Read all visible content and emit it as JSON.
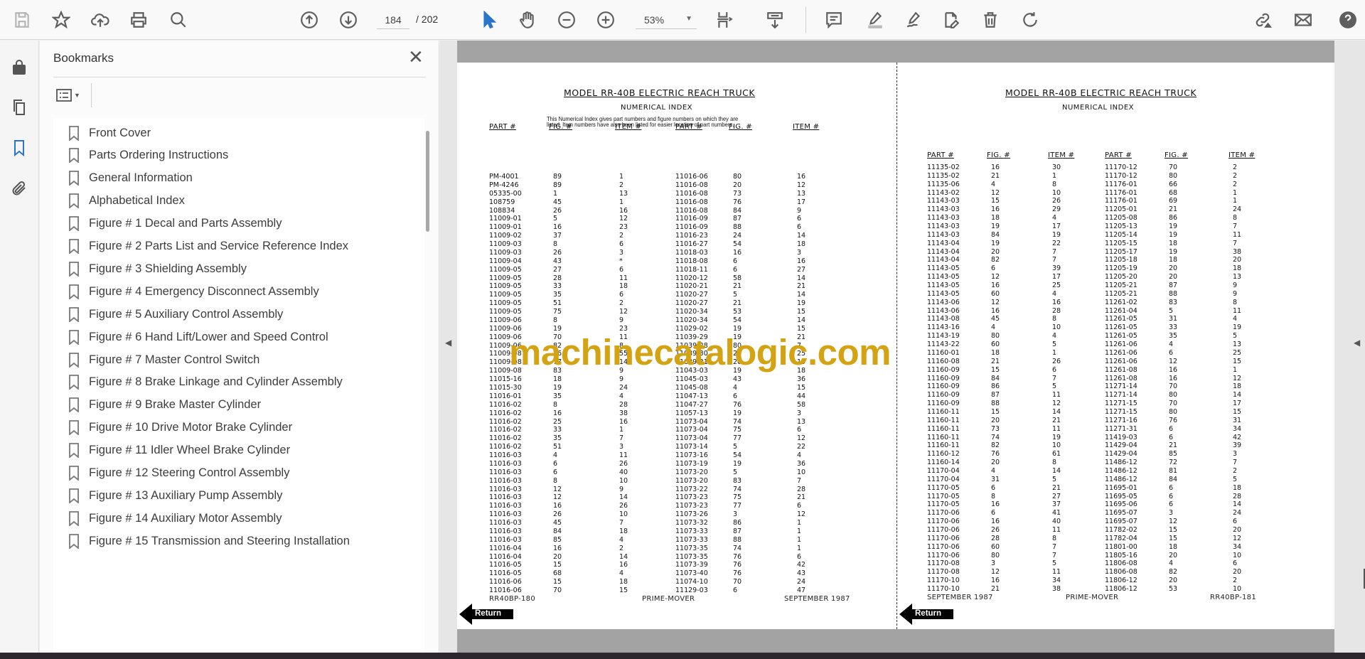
{
  "toolbar": {
    "icons": [
      "save-icon",
      "bookmark-star-icon",
      "upload-cloud-icon",
      "print-icon",
      "find-text-icon",
      "page-up-icon",
      "page-down-icon",
      "select-cursor-icon",
      "hand-pan-icon",
      "zoom-out-icon",
      "zoom-in-icon",
      "fit-page-icon",
      "scroll-mode-icon",
      "comment-icon",
      "highlight-icon",
      "sign-icon",
      "edit-pdf-icon",
      "delete-icon",
      "rotate-icon",
      "share-link-icon",
      "email-icon",
      "help-icon"
    ],
    "page_current": "184",
    "page_total": "/ 202",
    "zoom": "53%"
  },
  "rail": {
    "icons": [
      "lock-icon",
      "pages-icon",
      "bookmarks-icon",
      "attachments-icon"
    ],
    "active": "bookmarks-icon",
    "active_color": "#2b74c9"
  },
  "bookmarks": {
    "title": "Bookmarks",
    "close": "✕",
    "items": [
      "Front Cover",
      "Parts Ordering Instructions",
      "General Information",
      "Alphabetical Index",
      "Figure # 1 Decal and Parts Assembly",
      "Figure # 2 Parts List and Service Reference Index",
      "Figure # 3 Shielding Assembly",
      "Figure # 4 Emergency Disconnect Assembly",
      "Figure # 5 Auxiliary Control Assembly",
      "Figure # 6 Hand Lift/Lower and Speed Control",
      "Figure # 7 Master Control Switch",
      "Figure # 8 Brake Linkage and Cylinder Assembly",
      "Figure # 9 Brake Master Cylinder",
      "Figure # 10 Drive Motor Brake Cylinder",
      "Figure # 11 Idler Wheel Brake Cylinder",
      "Figure # 12 Steering Control Assembly",
      "Figure # 13 Auxiliary Pump Assembly",
      "Figure # 14 Auxiliary Motor Assembly",
      "Figure # 15 Transmission and Steering Installation"
    ]
  },
  "watermark": "machinecatalogic.com",
  "pages": {
    "left": {
      "title": "MODEL RR-40B ELECTRIC REACH TRUCK",
      "subtitle": "NUMERICAL INDEX",
      "note_line1": "This Numerical Index gives part numbers and figure numbers on which they are",
      "note_line2": "listed.  Item numbers have also been listed for easier location of part numbers.",
      "headers": [
        "PART #",
        "FIG. #",
        "ITEM #",
        "PART #",
        "FIG. #",
        "ITEM #"
      ],
      "col1": [
        [
          "PM-4001",
          "89",
          "1"
        ],
        [
          "PM-4246",
          "89",
          "2"
        ],
        [
          "05335-00",
          "1",
          "13"
        ],
        [
          "108759",
          "45",
          "1"
        ],
        [
          "108834",
          "26",
          "16"
        ],
        [
          "11009-01",
          "5",
          "12"
        ],
        [
          "11009-01",
          "16",
          "23"
        ],
        [
          "11009-02",
          "37",
          "2"
        ],
        [
          "11009-03",
          "8",
          "6"
        ],
        [
          "11009-03",
          "26",
          "3"
        ],
        [
          "11009-04",
          "43",
          "*"
        ],
        [
          "11009-05",
          "27",
          "6"
        ],
        [
          "11009-05",
          "28",
          "11"
        ],
        [
          "11009-05",
          "33",
          "18"
        ],
        [
          "11009-05",
          "35",
          "6"
        ],
        [
          "11009-05",
          "51",
          "2"
        ],
        [
          "11009-05",
          "75",
          "12"
        ],
        [
          "11009-06",
          "8",
          "9"
        ],
        [
          "11009-06",
          "19",
          "23"
        ],
        [
          "11009-06",
          "70",
          "11"
        ],
        [
          "11009-06",
          "82",
          "8"
        ],
        [
          "11009-08",
          "76",
          "55"
        ],
        [
          "11009-08",
          "77",
          "14"
        ],
        [
          "11009-08",
          "83",
          "9"
        ],
        [
          "11015-16",
          "18",
          "9"
        ],
        [
          "11015-30",
          "19",
          "24"
        ],
        [
          "11016-01",
          "35",
          "4"
        ],
        [
          "11016-02",
          "8",
          "28"
        ],
        [
          "11016-02",
          "16",
          "38"
        ],
        [
          "11016-02",
          "25",
          "16"
        ],
        [
          "11016-02",
          "33",
          "1"
        ],
        [
          "11016-02",
          "35",
          "7"
        ],
        [
          "11016-02",
          "51",
          "3"
        ],
        [
          "11016-03",
          "4",
          "11"
        ],
        [
          "11016-03",
          "6",
          "26"
        ],
        [
          "11016-03",
          "6",
          "40"
        ],
        [
          "11016-03",
          "8",
          "10"
        ],
        [
          "11016-03",
          "12",
          "9"
        ],
        [
          "11016-03",
          "12",
          "14"
        ],
        [
          "11016-03",
          "16",
          "26"
        ],
        [
          "11016-03",
          "26",
          "10"
        ],
        [
          "11016-03",
          "45",
          "7"
        ],
        [
          "11016-03",
          "84",
          "18"
        ],
        [
          "11016-03",
          "85",
          "4"
        ],
        [
          "11016-04",
          "16",
          "2"
        ],
        [
          "11016-04",
          "20",
          "14"
        ],
        [
          "11016-05",
          "15",
          "16"
        ],
        [
          "11016-05",
          "68",
          "4"
        ],
        [
          "11016-06",
          "15",
          "18"
        ],
        [
          "11016-06",
          "70",
          "15"
        ]
      ],
      "col2": [
        [
          "11016-06",
          "80",
          "16"
        ],
        [
          "11016-08",
          "20",
          "12"
        ],
        [
          "11016-08",
          "73",
          "13"
        ],
        [
          "11016-08",
          "76",
          "17"
        ],
        [
          "11016-08",
          "84",
          "9"
        ],
        [
          "11016-09",
          "87",
          "6"
        ],
        [
          "11016-09",
          "88",
          "6"
        ],
        [
          "11016-23",
          "24",
          "14"
        ],
        [
          "11016-27",
          "54",
          "18"
        ],
        [
          "11018-03",
          "16",
          "3"
        ],
        [
          "11018-08",
          "6",
          "16"
        ],
        [
          "11018-11",
          "6",
          "27"
        ],
        [
          "11020-12",
          "58",
          "14"
        ],
        [
          "11020-21",
          "21",
          "21"
        ],
        [
          "11020-27",
          "5",
          "14"
        ],
        [
          "11020-27",
          "21",
          "19"
        ],
        [
          "11020-34",
          "53",
          "15"
        ],
        [
          "11020-34",
          "54",
          "14"
        ],
        [
          "11029-02",
          "19",
          "15"
        ],
        [
          "11039-29",
          "19",
          "21"
        ],
        [
          "11039-28",
          "80",
          "7"
        ],
        [
          "11039-30",
          "21",
          "25"
        ],
        [
          "11039-31",
          "20",
          "19"
        ],
        [
          "11043-03",
          "19",
          "18"
        ],
        [
          "11045-03",
          "43",
          "36"
        ],
        [
          "11045-08",
          "4",
          "15"
        ],
        [
          "11047-13",
          "6",
          "44"
        ],
        [
          "11047-27",
          "76",
          "58"
        ],
        [
          "11057-13",
          "19",
          "3"
        ],
        [
          "11073-04",
          "74",
          "13"
        ],
        [
          "11073-04",
          "75",
          "6"
        ],
        [
          "11073-04",
          "77",
          "12"
        ],
        [
          "11073-14",
          "5",
          "22"
        ],
        [
          "11073-16",
          "54",
          "4"
        ],
        [
          "11073-19",
          "19",
          "36"
        ],
        [
          "11073-20",
          "5",
          "10"
        ],
        [
          "11073-20",
          "83",
          "7"
        ],
        [
          "11073-22",
          "74",
          "28"
        ],
        [
          "11073-23",
          "75",
          "21"
        ],
        [
          "11073-23",
          "77",
          "6"
        ],
        [
          "11073-26",
          "3",
          "12"
        ],
        [
          "11073-32",
          "86",
          "1"
        ],
        [
          "11073-33",
          "87",
          "1"
        ],
        [
          "11073-33",
          "88",
          "1"
        ],
        [
          "11073-35",
          "74",
          "1"
        ],
        [
          "11073-35",
          "76",
          "6"
        ],
        [
          "11073-39",
          "76",
          "42"
        ],
        [
          "11073-40",
          "76",
          "43"
        ],
        [
          "11074-10",
          "70",
          "24"
        ],
        [
          "11129-03",
          "6",
          "47"
        ]
      ],
      "footer": [
        "RR40BP-180",
        "PRIME-MOVER",
        "SEPTEMBER 1987"
      ],
      "return_label": "Return"
    },
    "right": {
      "title": "MODEL RR-40B ELECTRIC REACH TRUCK",
      "subtitle": "NUMERICAL INDEX",
      "headers": [
        "PART #",
        "FIG. #",
        "ITEM #",
        "PART #",
        "FIG. #",
        "ITEM #"
      ],
      "col1": [
        [
          "11135-02",
          "16",
          "30"
        ],
        [
          "11135-02",
          "21",
          "1"
        ],
        [
          "11135-06",
          "4",
          "8"
        ],
        [
          "11143-02",
          "12",
          "10"
        ],
        [
          "11143-03",
          "15",
          "26"
        ],
        [
          "11143-03",
          "16",
          "29"
        ],
        [
          "11143-03",
          "18",
          "4"
        ],
        [
          "11143-03",
          "19",
          "17"
        ],
        [
          "11143-03",
          "84",
          "19"
        ],
        [
          "11143-04",
          "19",
          "22"
        ],
        [
          "11143-04",
          "20",
          "7"
        ],
        [
          "11143-04",
          "82",
          "7"
        ],
        [
          "11143-05",
          "6",
          "39"
        ],
        [
          "11143-05",
          "12",
          "17"
        ],
        [
          "11143-05",
          "16",
          "25"
        ],
        [
          "11143-05",
          "60",
          "4"
        ],
        [
          "11143-06",
          "12",
          "16"
        ],
        [
          "11143-06",
          "16",
          "28"
        ],
        [
          "11143-08",
          "45",
          "8"
        ],
        [
          "11143-16",
          "4",
          "10"
        ],
        [
          "11143-19",
          "80",
          "4"
        ],
        [
          "11143-22",
          "60",
          "5"
        ],
        [
          "11160-01",
          "18",
          "1"
        ],
        [
          "11160-08",
          "21",
          "26"
        ],
        [
          "11160-09",
          "15",
          "6"
        ],
        [
          "11160-09",
          "84",
          "7"
        ],
        [
          "11160-09",
          "86",
          "5"
        ],
        [
          "11160-09",
          "87",
          "11"
        ],
        [
          "11160-09",
          "88",
          "12"
        ],
        [
          "11160-11",
          "15",
          "14"
        ],
        [
          "11160-11",
          "20",
          "21"
        ],
        [
          "11160-11",
          "73",
          "11"
        ],
        [
          "11160-11",
          "74",
          "19"
        ],
        [
          "11160-11",
          "82",
          "10"
        ],
        [
          "11160-12",
          "76",
          "61"
        ],
        [
          "11160-14",
          "20",
          "8"
        ],
        [
          "11170-04",
          "4",
          "14"
        ],
        [
          "11170-04",
          "31",
          "5"
        ],
        [
          "11170-05",
          "6",
          "21"
        ],
        [
          "11170-05",
          "8",
          "27"
        ],
        [
          "11170-05",
          "16",
          "37"
        ],
        [
          "11170-06",
          "6",
          "41"
        ],
        [
          "11170-06",
          "16",
          "40"
        ],
        [
          "11170-06",
          "26",
          "11"
        ],
        [
          "11170-06",
          "28",
          "8"
        ],
        [
          "11170-06",
          "60",
          "7"
        ],
        [
          "11170-06",
          "80",
          "7"
        ],
        [
          "11170-08",
          "3",
          "5"
        ],
        [
          "11170-08",
          "12",
          "11"
        ],
        [
          "11170-10",
          "16",
          "34"
        ],
        [
          "11170-10",
          "21",
          "38"
        ]
      ],
      "col2": [
        [
          "11170-12",
          "70",
          "2"
        ],
        [
          "11170-12",
          "80",
          "2"
        ],
        [
          "11176-01",
          "66",
          "2"
        ],
        [
          "11176-01",
          "68",
          "1"
        ],
        [
          "11176-01",
          "69",
          "1"
        ],
        [
          "11205-01",
          "21",
          "24"
        ],
        [
          "11205-08",
          "86",
          "8"
        ],
        [
          "11205-13",
          "19",
          "7"
        ],
        [
          "11205-14",
          "19",
          "11"
        ],
        [
          "11205-15",
          "18",
          "7"
        ],
        [
          "11205-17",
          "19",
          "38"
        ],
        [
          "11205-18",
          "18",
          "20"
        ],
        [
          "11205-19",
          "20",
          "18"
        ],
        [
          "11205-20",
          "20",
          "13"
        ],
        [
          "11205-21",
          "87",
          "9"
        ],
        [
          "11205-21",
          "88",
          "9"
        ],
        [
          "11261-02",
          "83",
          "8"
        ],
        [
          "11261-04",
          "5",
          "11"
        ],
        [
          "11261-05",
          "31",
          "4"
        ],
        [
          "11261-05",
          "33",
          "19"
        ],
        [
          "11261-05",
          "35",
          "5"
        ],
        [
          "11261-06",
          "4",
          "13"
        ],
        [
          "11261-06",
          "6",
          "25"
        ],
        [
          "11261-06",
          "12",
          "15"
        ],
        [
          "11261-08",
          "16",
          "1"
        ],
        [
          "11261-08",
          "16",
          "12"
        ],
        [
          "11271-14",
          "70",
          "18"
        ],
        [
          "11271-14",
          "80",
          "14"
        ],
        [
          "11271-15",
          "70",
          "17"
        ],
        [
          "11271-15",
          "80",
          "15"
        ],
        [
          "11271-16",
          "76",
          "31"
        ],
        [
          "11271-31",
          "6",
          "34"
        ],
        [
          "11419-03",
          "6",
          "42"
        ],
        [
          "11429-04",
          "21",
          "39"
        ],
        [
          "11429-04",
          "85",
          "3"
        ],
        [
          "11486-12",
          "72",
          "7"
        ],
        [
          "11486-12",
          "81",
          "2"
        ],
        [
          "11486-12",
          "84",
          "5"
        ],
        [
          "11695-01",
          "6",
          "18"
        ],
        [
          "11695-05",
          "6",
          "28"
        ],
        [
          "11695-06",
          "6",
          "14"
        ],
        [
          "11695-07",
          "3",
          "24"
        ],
        [
          "11695-07",
          "12",
          "6"
        ],
        [
          "11782-02",
          "15",
          "20"
        ],
        [
          "11782-04",
          "15",
          "12"
        ],
        [
          "11801-00",
          "18",
          "34"
        ],
        [
          "11805-16",
          "20",
          "10"
        ],
        [
          "11806-08",
          "4",
          "6"
        ],
        [
          "11806-08",
          "82",
          "20"
        ],
        [
          "11806-12",
          "20",
          "2"
        ],
        [
          "11806-12",
          "53",
          "10"
        ]
      ],
      "footer": [
        "SEPTEMBER 1987",
        "PRIME-MOVER",
        "RR40BP-181"
      ],
      "return_label": "Return"
    }
  }
}
